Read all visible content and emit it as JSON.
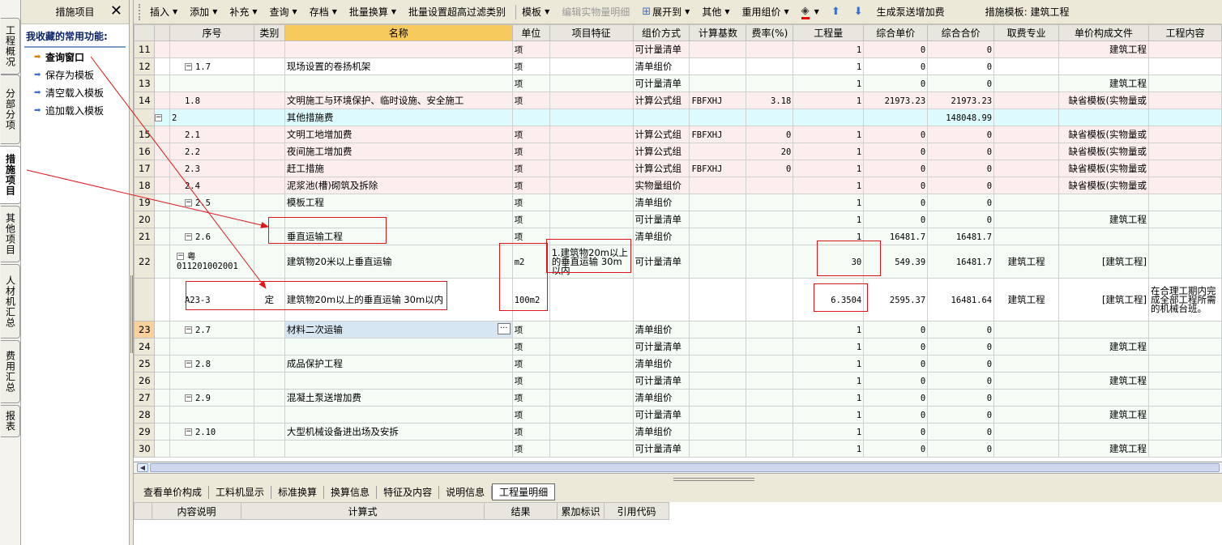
{
  "vertical_tabs": [
    "工程概况",
    "分部分项",
    "措施项目",
    "其他项目",
    "人材机汇总",
    "费用汇总",
    "报表"
  ],
  "fav": {
    "header": "措施项目",
    "close": "✕",
    "title": "我收藏的常用功能:",
    "items": [
      "查询窗口",
      "保存为模板",
      "清空载入模板",
      "追加载入模板"
    ]
  },
  "toolbar": {
    "items": [
      {
        "label": "插入",
        "dd": true
      },
      {
        "label": "添加",
        "dd": true
      },
      {
        "label": "补充",
        "dd": true
      },
      {
        "label": "查询",
        "dd": true
      },
      {
        "label": "存档",
        "dd": true
      },
      {
        "label": "批量换算",
        "dd": true
      },
      {
        "label": "批量设置超高过滤类别",
        "dd": false
      },
      {
        "sep": true
      },
      {
        "label": "模板",
        "dd": true
      },
      {
        "label": "编辑实物量明细",
        "dd": false,
        "disabled": true
      },
      {
        "label": "展开到",
        "dd": true,
        "icon": "expand-icon"
      },
      {
        "label": "其他",
        "dd": true
      },
      {
        "label": "重用组价",
        "dd": true
      },
      {
        "label": "",
        "dd": true,
        "icon": "paint-bucket-icon"
      },
      {
        "label": "",
        "icon": "arrow-up-icon"
      },
      {
        "label": "",
        "icon": "arrow-down-icon"
      },
      {
        "label": "生成泵送增加费",
        "dd": false
      }
    ],
    "template_label": "措施模板: 建筑工程"
  },
  "columns": [
    "",
    "",
    "序号",
    "类别",
    "名称",
    "单位",
    "项目特征",
    "组价方式",
    "计算基数",
    "费率(%)",
    "工程量",
    "综合单价",
    "综合合价",
    "取费专业",
    "单价构成文件",
    "工程内容"
  ],
  "rows": [
    {
      "rn": "11",
      "cls": "pink",
      "seq": "",
      "lvl": 1,
      "tree": "",
      "type": "",
      "name": "",
      "unit": "项",
      "feat": "",
      "method": "可计量清单",
      "base": "",
      "rate": "",
      "qty": "1",
      "uprice": "0",
      "total": "0",
      "major": "",
      "file": "建筑工程",
      "content": ""
    },
    {
      "rn": "12",
      "cls": "white",
      "seq": "1.7",
      "lvl": 1,
      "tree": "−",
      "type": "",
      "name": "现场设置的卷扬机架",
      "unit": "项",
      "feat": "",
      "method": "清单组价",
      "base": "",
      "rate": "",
      "qty": "1",
      "uprice": "0",
      "total": "0",
      "major": "",
      "file": "",
      "content": ""
    },
    {
      "rn": "13",
      "cls": "green",
      "seq": "",
      "lvl": 1,
      "tree": "",
      "type": "",
      "name": "",
      "unit": "项",
      "feat": "",
      "method": "可计量清单",
      "base": "",
      "rate": "",
      "qty": "1",
      "uprice": "0",
      "total": "0",
      "major": "",
      "file": "建筑工程",
      "content": ""
    },
    {
      "rn": "14",
      "cls": "pink",
      "seq": "1.8",
      "lvl": 1,
      "tree": "",
      "type": "",
      "name": "文明施工与环境保护、临时设施、安全施工",
      "unit": "项",
      "feat": "",
      "method": "计算公式组",
      "base": "FBFXHJ",
      "rate": "3.18",
      "qty": "1",
      "uprice": "21973.23",
      "total": "21973.23",
      "major": "",
      "file": "缺省模板(实物量或",
      "content": ""
    },
    {
      "rn": "",
      "cls": "cyan",
      "seq": "2",
      "lvl": 0,
      "tree": "−",
      "type": "",
      "name": "其他措施费",
      "unit": "",
      "feat": "",
      "method": "",
      "base": "",
      "rate": "",
      "qty": "",
      "uprice": "",
      "total": "148048.99",
      "major": "",
      "file": "",
      "content": ""
    },
    {
      "rn": "15",
      "cls": "pink",
      "seq": "2.1",
      "lvl": 1,
      "tree": "",
      "type": "",
      "name": "文明工地增加费",
      "unit": "项",
      "feat": "",
      "method": "计算公式组",
      "base": "FBFXHJ",
      "rate": "0",
      "qty": "1",
      "uprice": "0",
      "total": "0",
      "major": "",
      "file": "缺省模板(实物量或",
      "content": ""
    },
    {
      "rn": "16",
      "cls": "pink",
      "seq": "2.2",
      "lvl": 1,
      "tree": "",
      "type": "",
      "name": "夜间施工增加费",
      "unit": "项",
      "feat": "",
      "method": "计算公式组",
      "base": "",
      "rate": "20",
      "qty": "1",
      "uprice": "0",
      "total": "0",
      "major": "",
      "file": "缺省模板(实物量或",
      "content": ""
    },
    {
      "rn": "17",
      "cls": "pink",
      "seq": "2.3",
      "lvl": 1,
      "tree": "",
      "type": "",
      "name": "赶工措施",
      "unit": "项",
      "feat": "",
      "method": "计算公式组",
      "base": "FBFXHJ",
      "rate": "0",
      "qty": "1",
      "uprice": "0",
      "total": "0",
      "major": "",
      "file": "缺省模板(实物量或",
      "content": ""
    },
    {
      "rn": "18",
      "cls": "pink",
      "seq": "2.4",
      "lvl": 1,
      "tree": "",
      "type": "",
      "name": "泥浆池(槽)砌筑及拆除",
      "unit": "项",
      "feat": "",
      "method": "实物量组价",
      "base": "",
      "rate": "",
      "qty": "1",
      "uprice": "0",
      "total": "0",
      "major": "",
      "file": "缺省模板(实物量或",
      "content": ""
    },
    {
      "rn": "19",
      "cls": "green",
      "seq": "2.5",
      "lvl": 1,
      "tree": "−",
      "type": "",
      "name": "模板工程",
      "unit": "项",
      "feat": "",
      "method": "清单组价",
      "base": "",
      "rate": "",
      "qty": "1",
      "uprice": "0",
      "total": "0",
      "major": "",
      "file": "",
      "content": ""
    },
    {
      "rn": "20",
      "cls": "green",
      "seq": "",
      "lvl": 1,
      "tree": "",
      "type": "",
      "name": "",
      "unit": "项",
      "feat": "",
      "method": "可计量清单",
      "base": "",
      "rate": "",
      "qty": "1",
      "uprice": "0",
      "total": "0",
      "major": "",
      "file": "建筑工程",
      "content": ""
    },
    {
      "rn": "21",
      "cls": "green",
      "seq": "2.6",
      "lvl": 1,
      "tree": "−",
      "type": "",
      "name": "垂直运输工程",
      "unit": "项",
      "feat": "",
      "method": "清单组价",
      "base": "",
      "rate": "",
      "qty": "1",
      "uprice": "16481.7",
      "total": "16481.7",
      "major": "",
      "file": "",
      "content": ""
    },
    {
      "rn": "22",
      "cls": "green tall",
      "seq": "粤011201002001",
      "lvl": 2,
      "tree": "−",
      "type": "",
      "name": "建筑物20米以上垂直运输",
      "unit": "m2",
      "feat": "1.建筑物20m以上的垂直运输 30m以内",
      "method": "可计量清单",
      "base": "",
      "rate": "",
      "qty": "30",
      "uprice": "549.39",
      "total": "16481.7",
      "major": "建筑工程",
      "file": "[建筑工程]",
      "content": ""
    },
    {
      "rn": "",
      "cls": "white tall2",
      "seq": "A23-3",
      "lvl": 2,
      "tree": "",
      "type": "定",
      "name": "建筑物20m以上的垂直运输 30m以内",
      "unit": "100m2",
      "feat": "",
      "method": "",
      "base": "",
      "rate": "",
      "qty": "6.3504",
      "uprice": "2595.37",
      "total": "16481.64",
      "major": "建筑工程",
      "file": "[建筑工程]",
      "content": "在合理工期内完成全部工程所需的机械台班。"
    },
    {
      "rn": "23",
      "cls": "green sel",
      "seq": "2.7",
      "lvl": 1,
      "tree": "−",
      "type": "",
      "name": "材料二次运输",
      "unit": "项",
      "feat": "",
      "method": "清单组价",
      "base": "",
      "rate": "",
      "qty": "1",
      "uprice": "0",
      "total": "0",
      "major": "",
      "file": "",
      "content": ""
    },
    {
      "rn": "24",
      "cls": "green",
      "seq": "",
      "lvl": 1,
      "tree": "",
      "type": "",
      "name": "",
      "unit": "项",
      "feat": "",
      "method": "可计量清单",
      "base": "",
      "rate": "",
      "qty": "1",
      "uprice": "0",
      "total": "0",
      "major": "",
      "file": "建筑工程",
      "content": ""
    },
    {
      "rn": "25",
      "cls": "green",
      "seq": "2.8",
      "lvl": 1,
      "tree": "−",
      "type": "",
      "name": "成品保护工程",
      "unit": "项",
      "feat": "",
      "method": "清单组价",
      "base": "",
      "rate": "",
      "qty": "1",
      "uprice": "0",
      "total": "0",
      "major": "",
      "file": "",
      "content": ""
    },
    {
      "rn": "26",
      "cls": "green",
      "seq": "",
      "lvl": 1,
      "tree": "",
      "type": "",
      "name": "",
      "unit": "项",
      "feat": "",
      "method": "可计量清单",
      "base": "",
      "rate": "",
      "qty": "1",
      "uprice": "0",
      "total": "0",
      "major": "",
      "file": "建筑工程",
      "content": ""
    },
    {
      "rn": "27",
      "cls": "green",
      "seq": "2.9",
      "lvl": 1,
      "tree": "−",
      "type": "",
      "name": "混凝土泵送增加费",
      "unit": "项",
      "feat": "",
      "method": "清单组价",
      "base": "",
      "rate": "",
      "qty": "1",
      "uprice": "0",
      "total": "0",
      "major": "",
      "file": "",
      "content": ""
    },
    {
      "rn": "28",
      "cls": "green",
      "seq": "",
      "lvl": 1,
      "tree": "",
      "type": "",
      "name": "",
      "unit": "项",
      "feat": "",
      "method": "可计量清单",
      "base": "",
      "rate": "",
      "qty": "1",
      "uprice": "0",
      "total": "0",
      "major": "",
      "file": "建筑工程",
      "content": ""
    },
    {
      "rn": "29",
      "cls": "green",
      "seq": "2.10",
      "lvl": 1,
      "tree": "−",
      "type": "",
      "name": "大型机械设备进出场及安拆",
      "unit": "项",
      "feat": "",
      "method": "清单组价",
      "base": "",
      "rate": "",
      "qty": "1",
      "uprice": "0",
      "total": "0",
      "major": "",
      "file": "",
      "content": ""
    },
    {
      "rn": "30",
      "cls": "green",
      "seq": "",
      "lvl": 1,
      "tree": "",
      "type": "",
      "name": "",
      "unit": "项",
      "feat": "",
      "method": "可计量清单",
      "base": "",
      "rate": "",
      "qty": "1",
      "uprice": "0",
      "total": "0",
      "major": "",
      "file": "建筑工程",
      "content": ""
    }
  ],
  "bottom_tabs": [
    "查看单价构成",
    "工料机显示",
    "标准换算",
    "换算信息",
    "特征及内容",
    "说明信息",
    "工程量明细"
  ],
  "bottom_active": "工程量明细",
  "detail_columns": [
    "",
    "内容说明",
    "计算式",
    "结果",
    "累加标识",
    "引用代码"
  ],
  "colors": {
    "selected_header": "#f6ca5c",
    "annotation": "#e0151a"
  }
}
